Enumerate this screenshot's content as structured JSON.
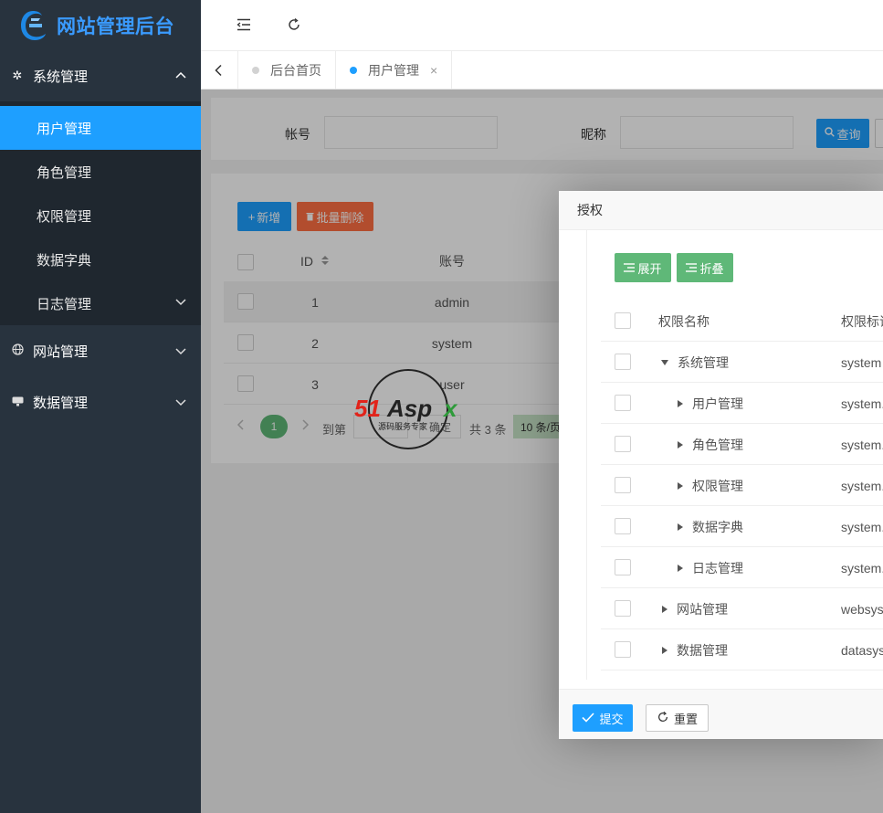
{
  "brand": {
    "title": "网站管理后台",
    "logo_icon": "brand-logo-icon"
  },
  "sidebar": {
    "groups": [
      {
        "label": "系统管理",
        "icon": "gear-icon",
        "expanded": true
      },
      {
        "label": "网站管理",
        "icon": "globe-icon",
        "expanded": false
      },
      {
        "label": "数据管理",
        "icon": "database-icon",
        "expanded": false
      }
    ],
    "sub_items": [
      {
        "label": "用户管理",
        "active": true
      },
      {
        "label": "角色管理"
      },
      {
        "label": "权限管理"
      },
      {
        "label": "数据字典"
      },
      {
        "label": "日志管理"
      }
    ],
    "accent": "#1e9fff"
  },
  "header": {
    "icons": [
      "collapse-menu-icon",
      "refresh-icon"
    ]
  },
  "tabs": [
    {
      "label": "后台首页"
    },
    {
      "label": "用户管理",
      "active": true,
      "close": "×"
    }
  ],
  "search": {
    "account_label": "帐号",
    "nickname_label": "昵称",
    "query_label": "查询"
  },
  "toolbar": {
    "add_label": "新增",
    "batch_delete_label": "批量删除"
  },
  "table": {
    "columns": [
      "ID",
      "账号"
    ],
    "rows": [
      {
        "id": "1",
        "account": "admin"
      },
      {
        "id": "2",
        "account": "system"
      },
      {
        "id": "3",
        "account": "user"
      }
    ]
  },
  "pager": {
    "current": "1",
    "goto_label": "到第",
    "confirm_label": "确定",
    "total_label": "共 3 条",
    "size_label": "10 条/页"
  },
  "watermark": {
    "text": "51Aspx",
    "subtext": "源码服务专家"
  },
  "modal": {
    "title": "授权",
    "expand_label": "展开",
    "collapse_label": "折叠",
    "columns": [
      "权限名称",
      "权限标识"
    ],
    "rows": [
      {
        "name": "系统管理",
        "key": "system",
        "level": 0,
        "caret": "down"
      },
      {
        "name": "用户管理",
        "key": "system.u",
        "level": 1,
        "caret": "right"
      },
      {
        "name": "角色管理",
        "key": "system.r",
        "level": 1,
        "caret": "right"
      },
      {
        "name": "权限管理",
        "key": "system.a",
        "level": 1,
        "caret": "right"
      },
      {
        "name": "数据字典",
        "key": "system.d",
        "level": 1,
        "caret": "right"
      },
      {
        "name": "日志管理",
        "key": "system.l",
        "level": 1,
        "caret": "right"
      },
      {
        "name": "网站管理",
        "key": "websys",
        "level": 0,
        "caret": "right"
      },
      {
        "name": "数据管理",
        "key": "datasys",
        "level": 0,
        "caret": "right"
      }
    ],
    "submit_label": "提交",
    "reset_label": "重置"
  }
}
